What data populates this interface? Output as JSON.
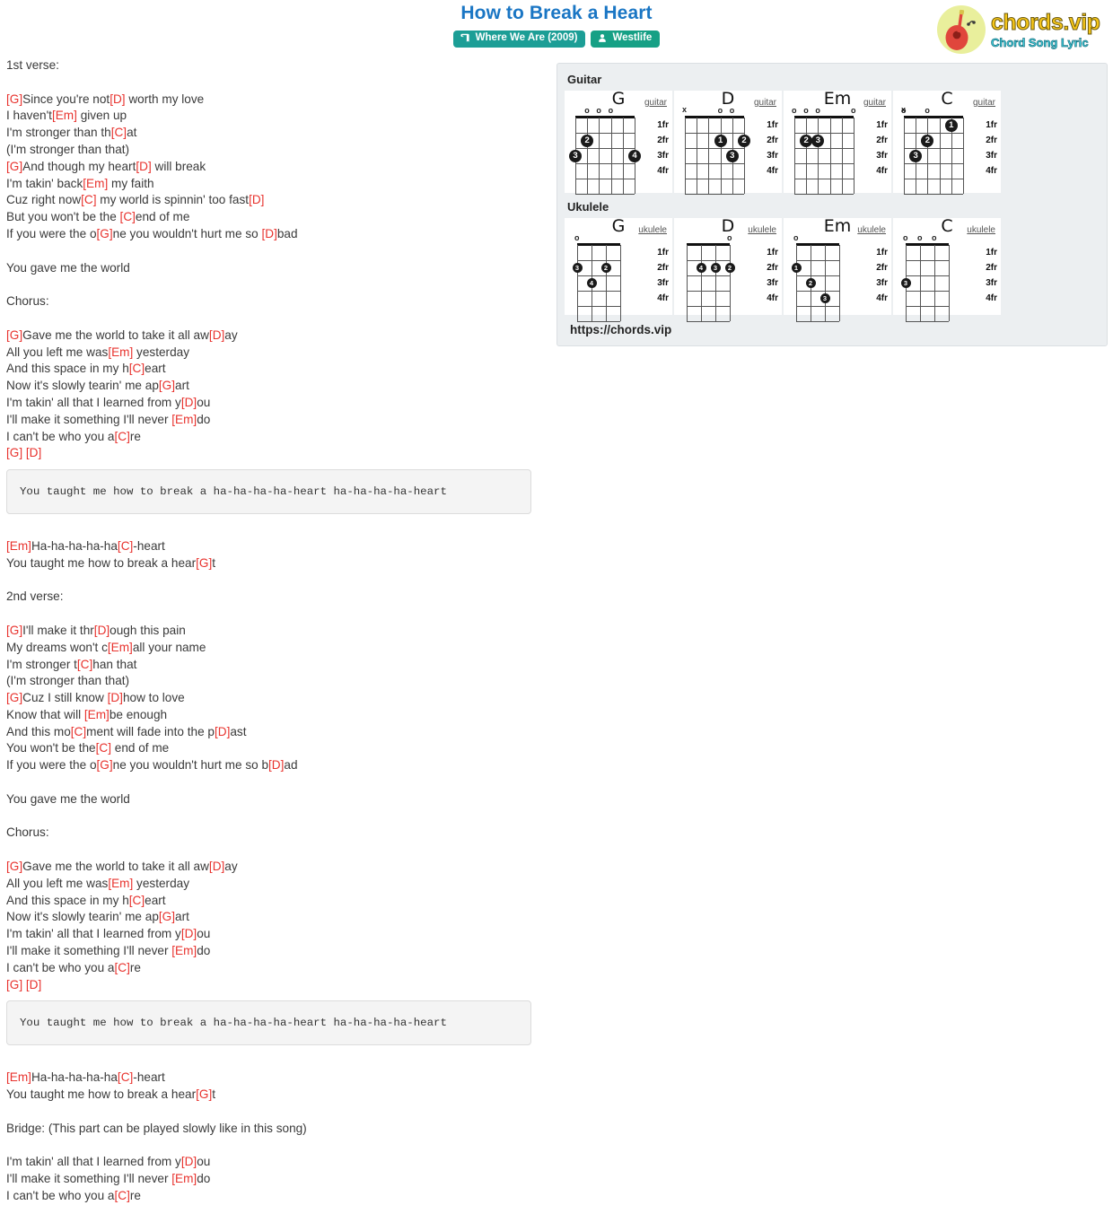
{
  "header": {
    "title": "How to Break a Heart",
    "album_badge": "Where We Are (2009)",
    "artist_badge": "Westlife",
    "album_icon": "book-icon",
    "artist_icon": "user-icon"
  },
  "logo": {
    "main": "chords.vip",
    "sub": "Chord Song Lyric",
    "icon": "guitar-icon"
  },
  "panel": {
    "guitar_label": "Guitar",
    "ukulele_label": "Ukulele",
    "url": "https://chords.vip",
    "fret_labels": [
      "1fr",
      "2fr",
      "3fr",
      "4fr"
    ],
    "guitar_chords": [
      {
        "name": "G",
        "type": "guitar",
        "open": [
          false,
          true,
          true,
          true,
          false,
          false
        ],
        "muted": [],
        "dots": [
          {
            "string": 5,
            "fret": 2,
            "finger": "2"
          },
          {
            "string": 6,
            "fret": 3,
            "finger": "3"
          },
          {
            "string": 1,
            "fret": 3,
            "finger": "4"
          }
        ]
      },
      {
        "name": "D",
        "type": "guitar",
        "open": [
          false,
          false,
          false,
          true,
          true,
          false
        ],
        "muted": [
          6
        ],
        "dots": [
          {
            "string": 3,
            "fret": 2,
            "finger": "1"
          },
          {
            "string": 1,
            "fret": 2,
            "finger": "2"
          },
          {
            "string": 2,
            "fret": 3,
            "finger": "3"
          }
        ]
      },
      {
        "name": "Em",
        "type": "guitar",
        "open": [
          true,
          true,
          true,
          false,
          false,
          true
        ],
        "muted": [],
        "dots": [
          {
            "string": 5,
            "fret": 2,
            "finger": "2"
          },
          {
            "string": 4,
            "fret": 2,
            "finger": "3"
          }
        ]
      },
      {
        "name": "C",
        "type": "guitar",
        "open": [
          true,
          false,
          true,
          false,
          false,
          false
        ],
        "muted": [
          6
        ],
        "dots": [
          {
            "string": 2,
            "fret": 1,
            "finger": "1"
          },
          {
            "string": 4,
            "fret": 2,
            "finger": "2"
          },
          {
            "string": 5,
            "fret": 3,
            "finger": "3"
          }
        ]
      }
    ],
    "ukulele_chords": [
      {
        "name": "G",
        "type": "ukulele",
        "open": [
          true,
          false,
          false,
          false
        ],
        "dots": [
          {
            "string": 2,
            "fret": 2,
            "finger": "2"
          },
          {
            "string": 4,
            "fret": 2,
            "finger": "3"
          },
          {
            "string": 3,
            "fret": 3,
            "finger": "4"
          }
        ]
      },
      {
        "name": "D",
        "type": "ukulele",
        "open": [
          false,
          false,
          false,
          true
        ],
        "dots": [
          {
            "string": 1,
            "fret": 2,
            "finger": "2"
          },
          {
            "string": 2,
            "fret": 2,
            "finger": "3"
          },
          {
            "string": 3,
            "fret": 2,
            "finger": "4"
          }
        ]
      },
      {
        "name": "Em",
        "type": "ukulele",
        "open": [
          true,
          false,
          false,
          false
        ],
        "dots": [
          {
            "string": 4,
            "fret": 2,
            "finger": "1"
          },
          {
            "string": 3,
            "fret": 3,
            "finger": "2"
          },
          {
            "string": 2,
            "fret": 4,
            "finger": "3"
          }
        ]
      },
      {
        "name": "C",
        "type": "ukulele",
        "open": [
          true,
          true,
          true,
          false
        ],
        "dots": [
          {
            "string": 4,
            "fret": 3,
            "finger": "3"
          }
        ]
      }
    ]
  },
  "lyrics": {
    "lines": [
      {
        "t": "plain",
        "text": "1st verse:"
      },
      {
        "t": "blank"
      },
      {
        "t": "chorded",
        "parts": [
          {
            "c": "[G]"
          },
          {
            "p": "Since you're not"
          },
          {
            "c": "[D]"
          },
          {
            "p": " worth my love"
          }
        ]
      },
      {
        "t": "chorded",
        "parts": [
          {
            "p": "I haven't"
          },
          {
            "c": "[Em]"
          },
          {
            "p": " given up"
          }
        ]
      },
      {
        "t": "chorded",
        "parts": [
          {
            "p": "I'm stronger than th"
          },
          {
            "c": "[C]"
          },
          {
            "p": "at"
          }
        ]
      },
      {
        "t": "plain",
        "text": "(I'm stronger than that)"
      },
      {
        "t": "chorded",
        "parts": [
          {
            "c": "[G]"
          },
          {
            "p": "And though my heart"
          },
          {
            "c": "[D]"
          },
          {
            "p": " will break"
          }
        ]
      },
      {
        "t": "chorded",
        "parts": [
          {
            "p": "I'm takin' back"
          },
          {
            "c": "[Em]"
          },
          {
            "p": " my faith"
          }
        ]
      },
      {
        "t": "chorded",
        "parts": [
          {
            "p": "Cuz right now"
          },
          {
            "c": "[C]"
          },
          {
            "p": " my world is spinnin' too fast"
          },
          {
            "c": "[D]"
          }
        ]
      },
      {
        "t": "chorded",
        "parts": [
          {
            "p": "But you won't be the "
          },
          {
            "c": "[C]"
          },
          {
            "p": "end of me"
          }
        ]
      },
      {
        "t": "chorded",
        "parts": [
          {
            "p": "If you were the o"
          },
          {
            "c": "[G]"
          },
          {
            "p": "ne you wouldn't hurt me so "
          },
          {
            "c": "[D]"
          },
          {
            "p": "bad"
          }
        ]
      },
      {
        "t": "blank"
      },
      {
        "t": "plain",
        "text": "You gave me the world"
      },
      {
        "t": "blank"
      },
      {
        "t": "plain",
        "text": "Chorus:"
      },
      {
        "t": "blank"
      },
      {
        "t": "chorded",
        "parts": [
          {
            "c": "[G]"
          },
          {
            "p": "Gave me the world to take it all aw"
          },
          {
            "c": "[D]"
          },
          {
            "p": "ay"
          }
        ]
      },
      {
        "t": "chorded",
        "parts": [
          {
            "p": "All you left me was"
          },
          {
            "c": "[Em]"
          },
          {
            "p": " yesterday"
          }
        ]
      },
      {
        "t": "chorded",
        "parts": [
          {
            "p": "And this space in my h"
          },
          {
            "c": "[C]"
          },
          {
            "p": "eart"
          }
        ]
      },
      {
        "t": "chorded",
        "parts": [
          {
            "p": "Now it's slowly tearin' me ap"
          },
          {
            "c": "[G]"
          },
          {
            "p": "art"
          }
        ]
      },
      {
        "t": "chorded",
        "parts": [
          {
            "p": "I'm takin' all that I learned from y"
          },
          {
            "c": "[D]"
          },
          {
            "p": "ou"
          }
        ]
      },
      {
        "t": "chorded",
        "parts": [
          {
            "p": "I'll make it something I'll never "
          },
          {
            "c": "[Em]"
          },
          {
            "p": "do"
          }
        ]
      },
      {
        "t": "chorded",
        "parts": [
          {
            "p": "I can't be who you a"
          },
          {
            "c": "[C]"
          },
          {
            "p": "re"
          }
        ]
      },
      {
        "t": "chorded",
        "parts": [
          {
            "c": "[G] [D]"
          }
        ]
      },
      {
        "t": "pre",
        "text": "You taught me how to break a ha-ha-ha-ha-heart ha-ha-ha-ha-heart"
      },
      {
        "t": "blank"
      },
      {
        "t": "chorded",
        "parts": [
          {
            "c": "[Em]"
          },
          {
            "p": "Ha-ha-ha-ha-ha"
          },
          {
            "c": "[C]"
          },
          {
            "p": "-heart"
          }
        ]
      },
      {
        "t": "chorded",
        "parts": [
          {
            "p": "You taught me how to break a hear"
          },
          {
            "c": "[G]"
          },
          {
            "p": "t"
          }
        ]
      },
      {
        "t": "blank"
      },
      {
        "t": "plain",
        "text": "2nd verse:"
      },
      {
        "t": "blank"
      },
      {
        "t": "chorded",
        "parts": [
          {
            "c": "[G]"
          },
          {
            "p": "I'll make it thr"
          },
          {
            "c": "[D]"
          },
          {
            "p": "ough this pain"
          }
        ]
      },
      {
        "t": "chorded",
        "parts": [
          {
            "p": "My dreams won't c"
          },
          {
            "c": "[Em]"
          },
          {
            "p": "all your name"
          }
        ]
      },
      {
        "t": "chorded",
        "parts": [
          {
            "p": "I'm stronger t"
          },
          {
            "c": "[C]"
          },
          {
            "p": "han that"
          }
        ]
      },
      {
        "t": "plain",
        "text": "(I'm stronger than that)"
      },
      {
        "t": "chorded",
        "parts": [
          {
            "c": "[G]"
          },
          {
            "p": "Cuz I still know "
          },
          {
            "c": "[D]"
          },
          {
            "p": "how to love"
          }
        ]
      },
      {
        "t": "chorded",
        "parts": [
          {
            "p": "Know that will "
          },
          {
            "c": "[Em]"
          },
          {
            "p": "be enough"
          }
        ]
      },
      {
        "t": "chorded",
        "parts": [
          {
            "p": "And this mo"
          },
          {
            "c": "[C]"
          },
          {
            "p": "ment will fade into the p"
          },
          {
            "c": "[D]"
          },
          {
            "p": "ast"
          }
        ]
      },
      {
        "t": "chorded",
        "parts": [
          {
            "p": "You won't be the"
          },
          {
            "c": "[C]"
          },
          {
            "p": " end of me"
          }
        ]
      },
      {
        "t": "chorded",
        "parts": [
          {
            "p": "If you were the o"
          },
          {
            "c": "[G]"
          },
          {
            "p": "ne you wouldn't hurt me so b"
          },
          {
            "c": "[D]"
          },
          {
            "p": "ad"
          }
        ]
      },
      {
        "t": "blank"
      },
      {
        "t": "plain",
        "text": "You gave me the world"
      },
      {
        "t": "blank"
      },
      {
        "t": "plain",
        "text": "Chorus:"
      },
      {
        "t": "blank"
      },
      {
        "t": "chorded",
        "parts": [
          {
            "c": "[G]"
          },
          {
            "p": "Gave me the world to take it all aw"
          },
          {
            "c": "[D]"
          },
          {
            "p": "ay"
          }
        ]
      },
      {
        "t": "chorded",
        "parts": [
          {
            "p": "All you left me was"
          },
          {
            "c": "[Em]"
          },
          {
            "p": " yesterday"
          }
        ]
      },
      {
        "t": "chorded",
        "parts": [
          {
            "p": "And this space in my h"
          },
          {
            "c": "[C]"
          },
          {
            "p": "eart"
          }
        ]
      },
      {
        "t": "chorded",
        "parts": [
          {
            "p": "Now it's slowly tearin' me ap"
          },
          {
            "c": "[G]"
          },
          {
            "p": "art"
          }
        ]
      },
      {
        "t": "chorded",
        "parts": [
          {
            "p": "I'm takin' all that I learned from y"
          },
          {
            "c": "[D]"
          },
          {
            "p": "ou"
          }
        ]
      },
      {
        "t": "chorded",
        "parts": [
          {
            "p": "I'll make it something I'll never "
          },
          {
            "c": "[Em]"
          },
          {
            "p": "do"
          }
        ]
      },
      {
        "t": "chorded",
        "parts": [
          {
            "p": "I can't be who you a"
          },
          {
            "c": "[C]"
          },
          {
            "p": "re"
          }
        ]
      },
      {
        "t": "chorded",
        "parts": [
          {
            "c": "[G] [D]"
          }
        ]
      },
      {
        "t": "pre",
        "text": "You taught me how to break a ha-ha-ha-ha-heart ha-ha-ha-ha-heart"
      },
      {
        "t": "blank"
      },
      {
        "t": "chorded",
        "parts": [
          {
            "c": "[Em]"
          },
          {
            "p": "Ha-ha-ha-ha-ha"
          },
          {
            "c": "[C]"
          },
          {
            "p": "-heart"
          }
        ]
      },
      {
        "t": "chorded",
        "parts": [
          {
            "p": "You taught me how to break a hear"
          },
          {
            "c": "[G]"
          },
          {
            "p": "t"
          }
        ]
      },
      {
        "t": "blank"
      },
      {
        "t": "plain",
        "text": "Bridge: (This part can be played slowly like in this song)"
      },
      {
        "t": "blank"
      },
      {
        "t": "chorded",
        "parts": [
          {
            "p": "I'm takin' all that I learned from y"
          },
          {
            "c": "[D]"
          },
          {
            "p": "ou"
          }
        ]
      },
      {
        "t": "chorded",
        "parts": [
          {
            "p": "I'll make it something I'll never "
          },
          {
            "c": "[Em]"
          },
          {
            "p": "do"
          }
        ]
      },
      {
        "t": "chorded",
        "parts": [
          {
            "p": "I can't be who you a"
          },
          {
            "c": "[C]"
          },
          {
            "p": "re"
          }
        ]
      }
    ]
  }
}
